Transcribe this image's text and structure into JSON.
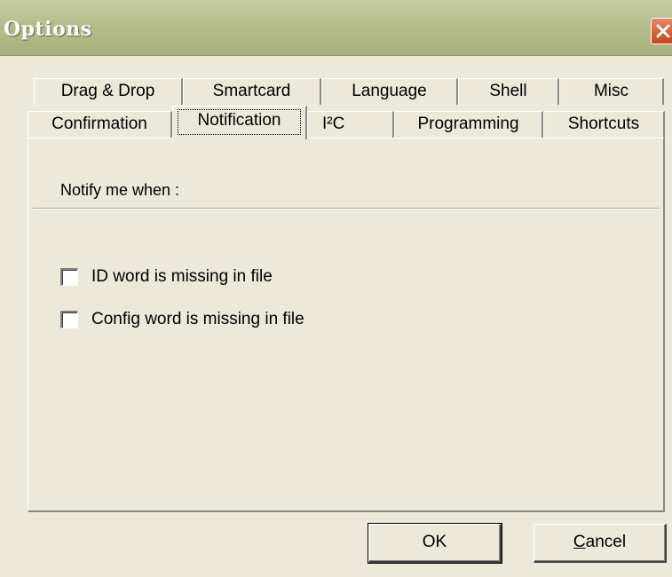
{
  "window": {
    "title": "Options",
    "close_icon": "close-icon"
  },
  "tabs": {
    "row_back": [
      "Drag & Drop",
      "Smartcard",
      "Language",
      "Shell",
      "Misc"
    ],
    "row_front": [
      "Confirmation",
      "Notification",
      "I²C",
      "Programming",
      "Shortcuts"
    ],
    "selected": "Notification"
  },
  "panel": {
    "group_label": "Notify me when :",
    "options": [
      {
        "label": "ID word is missing in file",
        "checked": false
      },
      {
        "label": "Config word is missing in file",
        "checked": false
      }
    ]
  },
  "buttons": {
    "ok": "OK",
    "cancel_first": "C",
    "cancel_rest": "ancel"
  },
  "colors": {
    "background": "#ece9d8",
    "titlebar": "#b6bf8c",
    "close": "#c4431d"
  }
}
